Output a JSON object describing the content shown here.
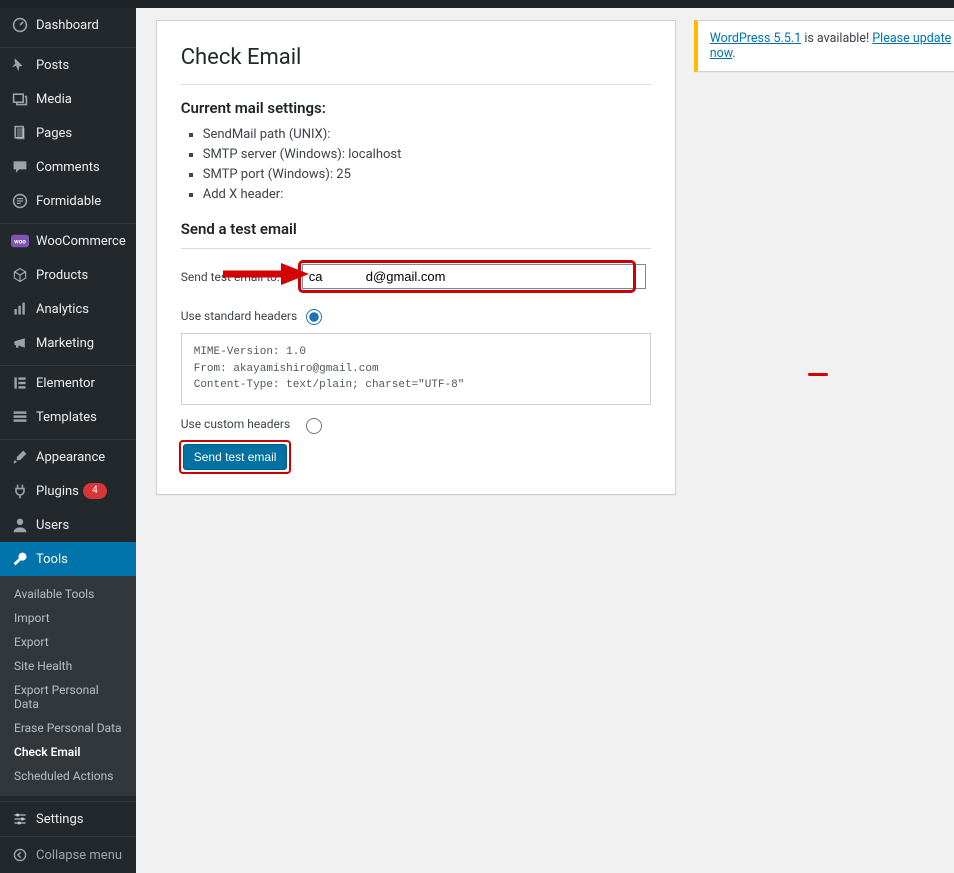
{
  "sidebar": {
    "items": [
      {
        "icon": "dashboard",
        "label": "Dashboard"
      },
      {
        "icon": "pin",
        "label": "Posts"
      },
      {
        "icon": "media",
        "label": "Media"
      },
      {
        "icon": "page",
        "label": "Pages"
      },
      {
        "icon": "comment",
        "label": "Comments"
      },
      {
        "icon": "formidable",
        "label": "Formidable"
      },
      {
        "icon": "woo",
        "label": "WooCommerce"
      },
      {
        "icon": "cube",
        "label": "Products"
      },
      {
        "icon": "bars",
        "label": "Analytics"
      },
      {
        "icon": "megaphone",
        "label": "Marketing"
      },
      {
        "icon": "elementor",
        "label": "Elementor"
      },
      {
        "icon": "templates",
        "label": "Templates"
      },
      {
        "icon": "brush",
        "label": "Appearance"
      },
      {
        "icon": "plug",
        "label": "Plugins",
        "badge": "4"
      },
      {
        "icon": "user",
        "label": "Users"
      },
      {
        "icon": "wrench",
        "label": "Tools",
        "active": true
      },
      {
        "icon": "sliders",
        "label": "Settings"
      }
    ],
    "submenu": [
      "Available Tools",
      "Import",
      "Export",
      "Site Health",
      "Export Personal Data",
      "Erase Personal Data",
      "Check Email",
      "Scheduled Actions"
    ],
    "submenu_current": "Check Email",
    "collapse_label": "Collapse menu"
  },
  "page": {
    "title": "Check Email",
    "settings_heading": "Current mail settings:",
    "settings": [
      {
        "key": "SendMail path (UNIX):",
        "val": ""
      },
      {
        "key": "SMTP server (Windows):",
        "val": "localhost"
      },
      {
        "key": "SMTP port (Windows):",
        "val": "25"
      },
      {
        "key": "Add X header:",
        "val": ""
      }
    ],
    "send_heading": "Send a test email",
    "send_to_label": "Send test email to:",
    "email_value_left": "ca",
    "email_value_right": "d@gmail.com",
    "standard_label": "Use standard headers",
    "headers_preview": "MIME-Version: 1.0\nFrom: akayamishiro@gmail.com\nContent-Type: text/plain; charset=\"UTF-8\"",
    "custom_label": "Use custom headers",
    "send_button": "Send test email"
  },
  "notice": {
    "link1": "WordPress 5.5.1",
    "mid": " is available! ",
    "link2": "Please update now",
    "tail": "."
  }
}
